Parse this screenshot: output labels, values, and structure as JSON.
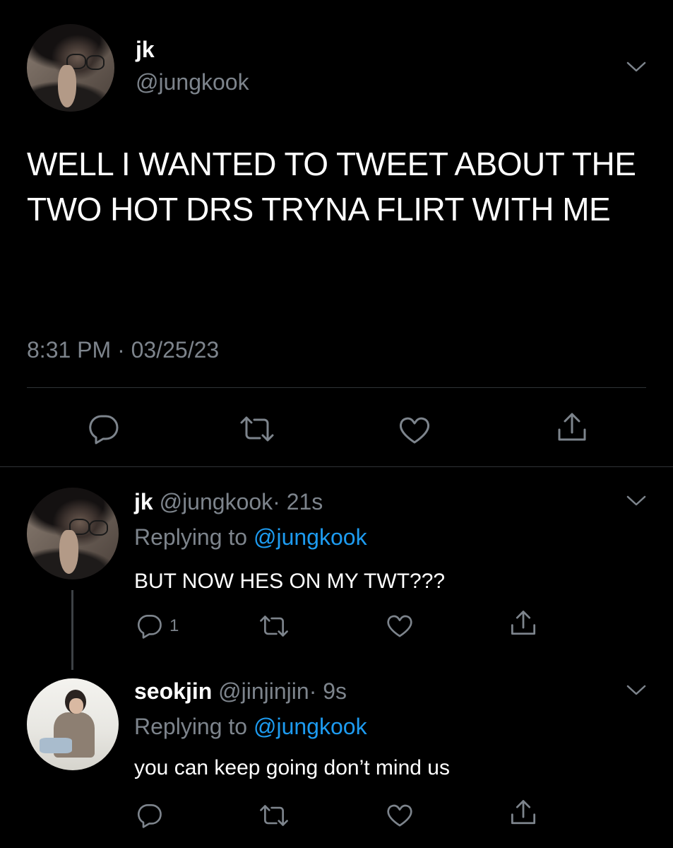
{
  "main_tweet": {
    "display_name": "jk",
    "handle": "@jungkook",
    "text": "WELL I WANTED TO TWEET ABOUT THE TWO HOT DRS TRYNA FLIRT WITH ME",
    "timestamp": "8:31 PM · 03/25/23"
  },
  "replies": [
    {
      "display_name": "jk",
      "handle": "@jungkook",
      "time": "· 21s",
      "replying_label": "Replying to",
      "replying_to": "@jungkook",
      "text": "BUT NOW HES ON MY TWT???",
      "reply_count": "1"
    },
    {
      "display_name": "seokjin",
      "handle": "@jinjinjin",
      "time": "· 9s",
      "replying_label": "Replying to",
      "replying_to": "@jungkook",
      "text": "you can keep going don’t mind us"
    }
  ],
  "icons": {
    "reply": "reply-icon",
    "retweet": "retweet-icon",
    "like": "heart-icon",
    "share": "share-icon",
    "more": "chevron-down-icon"
  },
  "colors": {
    "background": "#000000",
    "muted_text": "#7d848c",
    "link": "#1d9bf0",
    "divider": "#2f3336"
  }
}
